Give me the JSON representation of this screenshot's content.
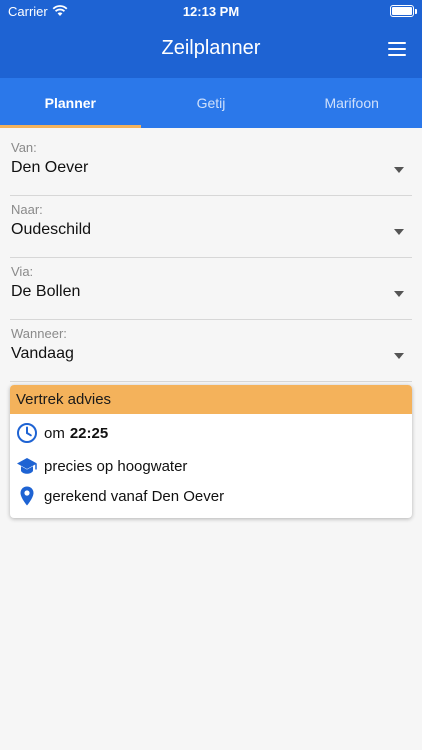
{
  "status_bar": {
    "carrier": "Carrier",
    "time": "12:13 PM"
  },
  "app_bar": {
    "title": "Zeilplanner",
    "menu_icon": "hamburger-menu-icon"
  },
  "tabs": [
    {
      "label": "Planner",
      "active": true
    },
    {
      "label": "Getij",
      "active": false
    },
    {
      "label": "Marifoon",
      "active": false
    }
  ],
  "form": {
    "van": {
      "label": "Van:",
      "value": "Den Oever"
    },
    "naar": {
      "label": "Naar:",
      "value": "Oudeschild"
    },
    "via": {
      "label": "Via:",
      "value": "De Bollen"
    },
    "wanneer": {
      "label": "Wanneer:",
      "value": "Vandaag"
    }
  },
  "advice": {
    "title": "Vertrek advies",
    "time_prefix": "om",
    "time": "22:25",
    "tide": "precies op hoogwater",
    "origin": "gerekend vanaf Den Oever"
  },
  "colors": {
    "primary": "#1e63d3",
    "tab_bar": "#2b78ea",
    "accent": "#f4b25b",
    "icon": "#1e63d3"
  }
}
